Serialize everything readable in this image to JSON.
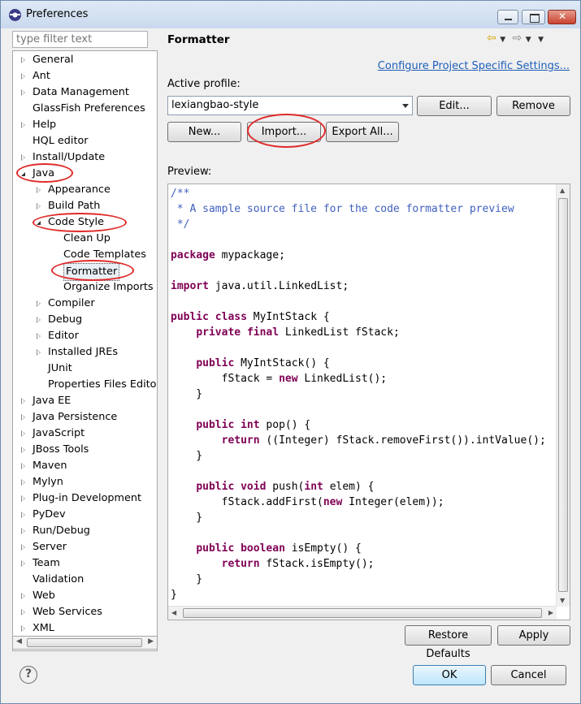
{
  "window": {
    "title": "Preferences"
  },
  "filter": {
    "placeholder": "type filter text"
  },
  "tree": [
    {
      "label": "General",
      "level": 0,
      "twisty": "closed"
    },
    {
      "label": "Ant",
      "level": 0,
      "twisty": "closed"
    },
    {
      "label": "Data Management",
      "level": 0,
      "twisty": "closed"
    },
    {
      "label": "GlassFish Preferences",
      "level": 0,
      "twisty": "none"
    },
    {
      "label": "Help",
      "level": 0,
      "twisty": "closed"
    },
    {
      "label": "HQL editor",
      "level": 0,
      "twisty": "none"
    },
    {
      "label": "Install/Update",
      "level": 0,
      "twisty": "closed"
    },
    {
      "label": "Java",
      "level": 0,
      "twisty": "open"
    },
    {
      "label": "Appearance",
      "level": 1,
      "twisty": "closed"
    },
    {
      "label": "Build Path",
      "level": 1,
      "twisty": "closed"
    },
    {
      "label": "Code Style",
      "level": 1,
      "twisty": "open"
    },
    {
      "label": "Clean Up",
      "level": 2,
      "twisty": "none"
    },
    {
      "label": "Code Templates",
      "level": 2,
      "twisty": "none"
    },
    {
      "label": "Formatter",
      "level": 2,
      "twisty": "none",
      "selected": true
    },
    {
      "label": "Organize Imports",
      "level": 2,
      "twisty": "none"
    },
    {
      "label": "Compiler",
      "level": 1,
      "twisty": "closed"
    },
    {
      "label": "Debug",
      "level": 1,
      "twisty": "closed"
    },
    {
      "label": "Editor",
      "level": 1,
      "twisty": "closed"
    },
    {
      "label": "Installed JREs",
      "level": 1,
      "twisty": "closed"
    },
    {
      "label": "JUnit",
      "level": 1,
      "twisty": "none"
    },
    {
      "label": "Properties Files Edito",
      "level": 1,
      "twisty": "none"
    },
    {
      "label": "Java EE",
      "level": 0,
      "twisty": "closed"
    },
    {
      "label": "Java Persistence",
      "level": 0,
      "twisty": "closed"
    },
    {
      "label": "JavaScript",
      "level": 0,
      "twisty": "closed"
    },
    {
      "label": "JBoss Tools",
      "level": 0,
      "twisty": "closed"
    },
    {
      "label": "Maven",
      "level": 0,
      "twisty": "closed"
    },
    {
      "label": "Mylyn",
      "level": 0,
      "twisty": "closed"
    },
    {
      "label": "Plug-in Development",
      "level": 0,
      "twisty": "closed"
    },
    {
      "label": "PyDev",
      "level": 0,
      "twisty": "closed"
    },
    {
      "label": "Run/Debug",
      "level": 0,
      "twisty": "closed"
    },
    {
      "label": "Server",
      "level": 0,
      "twisty": "closed"
    },
    {
      "label": "Team",
      "level": 0,
      "twisty": "closed"
    },
    {
      "label": "Validation",
      "level": 0,
      "twisty": "none"
    },
    {
      "label": "Web",
      "level": 0,
      "twisty": "closed"
    },
    {
      "label": "Web Services",
      "level": 0,
      "twisty": "closed"
    },
    {
      "label": "XML",
      "level": 0,
      "twisty": "closed"
    }
  ],
  "page": {
    "title": "Formatter",
    "configure_link": "Configure Project Specific Settings...",
    "active_profile_label": "Active profile:",
    "profile_value": "lexiangbao-style",
    "edit_button": "Edit...",
    "remove_button": "Remove",
    "new_button": "New...",
    "import_button": "Import...",
    "export_button": "Export All...",
    "preview_label": "Preview:",
    "restore_button": "Restore Defaults",
    "apply_button": "Apply"
  },
  "preview_code": [
    [
      [
        "cm",
        "/**"
      ]
    ],
    [
      [
        "cm",
        " * A sample source file for the code formatter preview"
      ]
    ],
    [
      [
        "cm",
        " */"
      ]
    ],
    [],
    [
      [
        "kw",
        "package"
      ],
      [
        "t",
        " mypackage;"
      ]
    ],
    [],
    [
      [
        "kw",
        "import"
      ],
      [
        "t",
        " java.util.LinkedList;"
      ]
    ],
    [],
    [
      [
        "kw",
        "public"
      ],
      [
        "t",
        " "
      ],
      [
        "kw",
        "class"
      ],
      [
        "t",
        " MyIntStack {"
      ]
    ],
    [
      [
        "t",
        "    "
      ],
      [
        "kw",
        "private"
      ],
      [
        "t",
        " "
      ],
      [
        "kw",
        "final"
      ],
      [
        "t",
        " LinkedList fStack;"
      ]
    ],
    [],
    [
      [
        "t",
        "    "
      ],
      [
        "kw",
        "public"
      ],
      [
        "t",
        " MyIntStack() {"
      ]
    ],
    [
      [
        "t",
        "        fStack = "
      ],
      [
        "kw",
        "new"
      ],
      [
        "t",
        " LinkedList();"
      ]
    ],
    [
      [
        "t",
        "    }"
      ]
    ],
    [],
    [
      [
        "t",
        "    "
      ],
      [
        "kw",
        "public"
      ],
      [
        "t",
        " "
      ],
      [
        "kw",
        "int"
      ],
      [
        "t",
        " pop() {"
      ]
    ],
    [
      [
        "t",
        "        "
      ],
      [
        "kw",
        "return"
      ],
      [
        "t",
        " ((Integer) fStack.removeFirst()).intValue();"
      ]
    ],
    [
      [
        "t",
        "    }"
      ]
    ],
    [],
    [
      [
        "t",
        "    "
      ],
      [
        "kw",
        "public"
      ],
      [
        "t",
        " "
      ],
      [
        "kw",
        "void"
      ],
      [
        "t",
        " push("
      ],
      [
        "kw",
        "int"
      ],
      [
        "t",
        " elem) {"
      ]
    ],
    [
      [
        "t",
        "        fStack.addFirst("
      ],
      [
        "kw",
        "new"
      ],
      [
        "t",
        " Integer(elem));"
      ]
    ],
    [
      [
        "t",
        "    }"
      ]
    ],
    [],
    [
      [
        "t",
        "    "
      ],
      [
        "kw",
        "public"
      ],
      [
        "t",
        " "
      ],
      [
        "kw",
        "boolean"
      ],
      [
        "t",
        " isEmpty() {"
      ]
    ],
    [
      [
        "t",
        "        "
      ],
      [
        "kw",
        "return"
      ],
      [
        "t",
        " fStack.isEmpty();"
      ]
    ],
    [
      [
        "t",
        "    }"
      ]
    ],
    [
      [
        "t",
        "}"
      ]
    ]
  ],
  "footer": {
    "ok_button": "OK",
    "cancel_button": "Cancel"
  },
  "icons": {
    "window": "eclipse-icon",
    "back": "back-arrow-icon",
    "forward": "forward-arrow-icon",
    "menu": "view-menu-icon",
    "help": "help-icon"
  }
}
